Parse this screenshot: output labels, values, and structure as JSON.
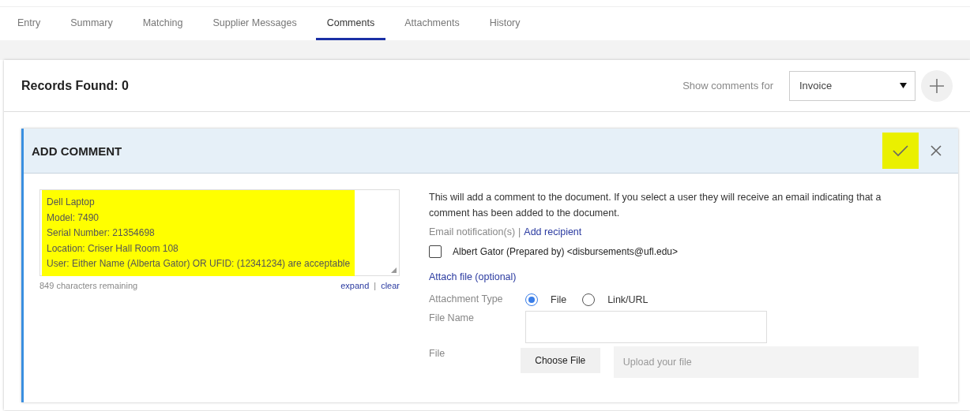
{
  "tabs": [
    {
      "label": "Entry",
      "selected": false
    },
    {
      "label": "Summary",
      "selected": false
    },
    {
      "label": "Matching",
      "selected": false
    },
    {
      "label": "Supplier Messages",
      "selected": false
    },
    {
      "label": "Comments",
      "selected": true
    },
    {
      "label": "Attachments",
      "selected": false
    },
    {
      "label": "History",
      "selected": false
    }
  ],
  "records": {
    "title": "Records Found: 0",
    "filter_label": "Show comments for",
    "filter_value": "Invoice"
  },
  "add_comment": {
    "title": "ADD COMMENT",
    "confirm_highlighted": true,
    "comment": {
      "lines": [
        "Dell Laptop",
        "Model: 7490",
        "Serial Number: 21354698",
        "Location: Criser Hall Room 108",
        "User: Either Name (Alberta Gator) OR UFID: (12341234) are acceptable"
      ],
      "highlighted": true
    },
    "remaining": "849 characters remaining",
    "expand": "expand",
    "separator": "|",
    "clear": "clear",
    "info": "This will add a comment to the document. If you select a user they will receive an email indicating that a comment has been added to the document.",
    "email_label": "Email notification(s)",
    "email_separator": "|",
    "add_recipient": "Add recipient",
    "recipients": [
      {
        "label": "Albert Gator (Prepared by) <disbursements@ufl.edu>",
        "checked": false
      }
    ],
    "attach_heading": "Attach file (optional)",
    "attachment_type_label": "Attachment Type",
    "attachment_types": [
      {
        "label": "File",
        "selected": true
      },
      {
        "label": "Link/URL",
        "selected": false
      }
    ],
    "file_name_label": "File Name",
    "file_label": "File",
    "choose_button": "Choose File",
    "upload_placeholder": "Upload your file"
  }
}
